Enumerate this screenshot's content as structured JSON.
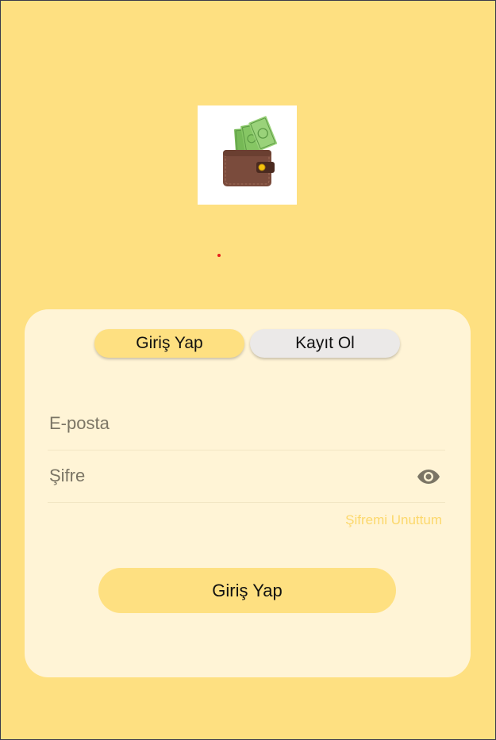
{
  "tabs": {
    "login_label": "Giriş Yap",
    "register_label": "Kayıt Ol",
    "active": "login"
  },
  "form": {
    "email_placeholder": "E-posta",
    "password_placeholder": "Şifre",
    "forgot_label": "Şifremi Unuttum",
    "submit_label": "Giriş Yap"
  },
  "icons": {
    "logo": "wallet-with-cash-icon",
    "password_toggle": "eye-icon"
  },
  "colors": {
    "background": "#fee081",
    "card": "#fff4d6",
    "accent": "#fee081",
    "inactive_tab": "#ebe9e8",
    "link": "#fcd86c",
    "placeholder_text": "#7b7565"
  }
}
